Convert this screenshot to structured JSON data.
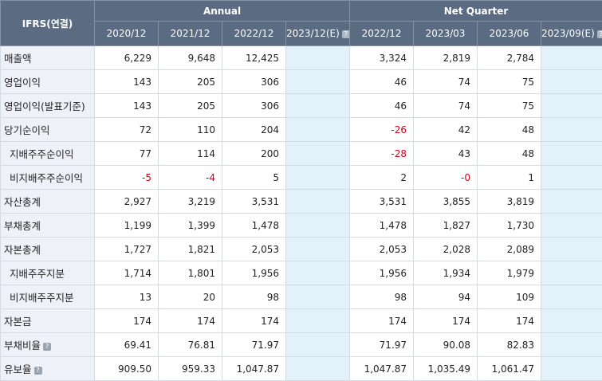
{
  "header": {
    "corner": "IFRS(연결)",
    "annual_label": "Annual",
    "quarter_label": "Net Quarter",
    "annual_periods": [
      "2020/12",
      "2021/12",
      "2022/12",
      "2023/12(E)"
    ],
    "quarter_periods": [
      "2022/12",
      "2023/03",
      "2023/06",
      "2023/09(E)"
    ],
    "help_glyph": "?"
  },
  "rows": [
    {
      "label": "매출액",
      "sub": false,
      "help": false,
      "annual": [
        "6,229",
        "9,648",
        "12,425",
        ""
      ],
      "quarter": [
        "3,324",
        "2,819",
        "2,784",
        ""
      ]
    },
    {
      "label": "영업이익",
      "sub": false,
      "help": false,
      "annual": [
        "143",
        "205",
        "306",
        ""
      ],
      "quarter": [
        "46",
        "74",
        "75",
        ""
      ]
    },
    {
      "label": "영업이익(발표기준)",
      "sub": false,
      "help": false,
      "annual": [
        "143",
        "205",
        "306",
        ""
      ],
      "quarter": [
        "46",
        "74",
        "75",
        ""
      ]
    },
    {
      "label": "당기순이익",
      "sub": false,
      "help": false,
      "annual": [
        "72",
        "110",
        "204",
        ""
      ],
      "quarter": [
        "-26",
        "42",
        "48",
        ""
      ]
    },
    {
      "label": "지배주주순이익",
      "sub": true,
      "help": false,
      "annual": [
        "77",
        "114",
        "200",
        ""
      ],
      "quarter": [
        "-28",
        "43",
        "48",
        ""
      ]
    },
    {
      "label": "비지배주주순이익",
      "sub": true,
      "help": false,
      "annual": [
        "-5",
        "-4",
        "5",
        ""
      ],
      "quarter": [
        "2",
        "-0",
        "1",
        ""
      ]
    },
    {
      "label": "자산총계",
      "sub": false,
      "help": false,
      "annual": [
        "2,927",
        "3,219",
        "3,531",
        ""
      ],
      "quarter": [
        "3,531",
        "3,855",
        "3,819",
        ""
      ]
    },
    {
      "label": "부채총계",
      "sub": false,
      "help": false,
      "annual": [
        "1,199",
        "1,399",
        "1,478",
        ""
      ],
      "quarter": [
        "1,478",
        "1,827",
        "1,730",
        ""
      ]
    },
    {
      "label": "자본총계",
      "sub": false,
      "help": false,
      "annual": [
        "1,727",
        "1,821",
        "2,053",
        ""
      ],
      "quarter": [
        "2,053",
        "2,028",
        "2,089",
        ""
      ]
    },
    {
      "label": "지배주주지분",
      "sub": true,
      "help": false,
      "annual": [
        "1,714",
        "1,801",
        "1,956",
        ""
      ],
      "quarter": [
        "1,956",
        "1,934",
        "1,979",
        ""
      ]
    },
    {
      "label": "비지배주주지분",
      "sub": true,
      "help": false,
      "annual": [
        "13",
        "20",
        "98",
        ""
      ],
      "quarter": [
        "98",
        "94",
        "109",
        ""
      ]
    },
    {
      "label": "자본금",
      "sub": false,
      "help": false,
      "annual": [
        "174",
        "174",
        "174",
        ""
      ],
      "quarter": [
        "174",
        "174",
        "174",
        ""
      ]
    },
    {
      "label": "부채비율",
      "sub": false,
      "help": true,
      "annual": [
        "69.41",
        "76.81",
        "71.97",
        ""
      ],
      "quarter": [
        "71.97",
        "90.08",
        "82.83",
        ""
      ]
    },
    {
      "label": "유보율",
      "sub": false,
      "help": true,
      "annual": [
        "909.50",
        "959.33",
        "1,047.87",
        ""
      ],
      "quarter": [
        "1,047.87",
        "1,035.49",
        "1,061.47",
        ""
      ]
    }
  ],
  "colors": {
    "header_bg": "#5a6b82",
    "label_bg": "#eef2f8",
    "estimate_bg": "#e3f1fb",
    "negative": "#d0021b"
  }
}
